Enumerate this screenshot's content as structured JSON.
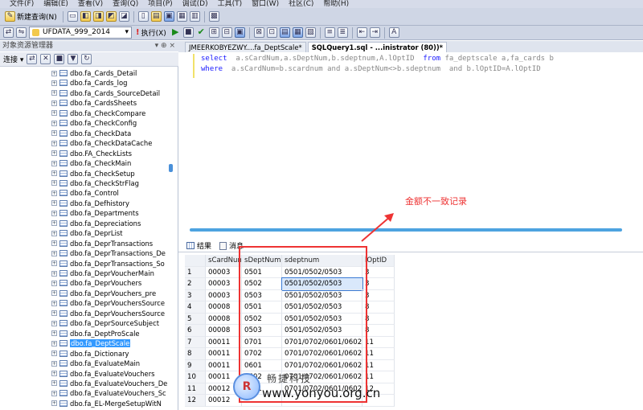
{
  "menu": {
    "items": [
      "文件(F)",
      "编辑(E)",
      "查看(V)",
      "查询(Q)",
      "项目(P)",
      "调试(D)",
      "工具(T)",
      "窗口(W)",
      "社区(C)",
      "帮助(H)"
    ]
  },
  "toolbar": {
    "new_query": "新建查询(N)",
    "database": "UFDATA_999_2014",
    "execute": "执行(X)"
  },
  "object_explorer": {
    "title": "对象资源管理器",
    "connect": "连接",
    "pin": "▾ ⊕ ×",
    "items": [
      "dbo.fa_Cards_Detail",
      "dbo.fa_Cards_log",
      "dbo.fa_Cards_SourceDetail",
      "dbo.fa_CardsSheets",
      "dbo.fa_CheckCompare",
      "dbo.fa_CheckConfig",
      "dbo.fa_CheckData",
      "dbo.fa_CheckDataCache",
      "dbo.FA_CheckLists",
      "dbo.fa_CheckMain",
      "dbo.fa_CheckSetup",
      "dbo.fa_CheckStrFlag",
      "dbo.fa_Control",
      "dbo.fa_Defhistory",
      "dbo.fa_Departments",
      "dbo.fa_Depreciations",
      "dbo.fa_DeprList",
      "dbo.fa_DeprTransactions",
      "dbo.fa_DeprTransactions_De",
      "dbo.fa_DeprTransactions_So",
      "dbo.fa_DeprVoucherMain",
      "dbo.fa_DeprVouchers",
      "dbo.fa_DeprVouchers_pre",
      "dbo.fa_DeprVouchersSource",
      "dbo.fa_DeprVouchersSource",
      "dbo.fa_DeprSourceSubject",
      "dbo.fa_DeptProScale",
      "dbo.fa_DeptScale",
      "dbo.fa_Dictionary",
      "dbo.fa_EvaluateMain",
      "dbo.fa_EvaluateVouchers",
      "dbo.fa_EvaluateVouchers_De",
      "dbo.fa_EvaluateVouchers_Sc",
      "dbo.fa_EL-MergeSetupWitN"
    ],
    "selected_index": 27
  },
  "tabs": [
    {
      "label": "JMEERKOBYEZWY....fa_DeptScale*"
    },
    {
      "label": "SQLQuery1.sql - ...inistrator (80))*"
    }
  ],
  "editor": {
    "line1": {
      "kw1": "select",
      "rest1": "  a.sCardNum,a.sDeptNum,b.sdeptnum,A.lOptID  ",
      "kw2": "from",
      "rest2": " fa_deptscale a,fa_cards b"
    },
    "line2": {
      "kw1": "where",
      "rest1": "  a.sCardNum=b.scardnum and a.sDeptNum<>b.sdeptnum  and b.lOptID=A.lOptID"
    }
  },
  "annotation": "金额不一致记录",
  "results": {
    "tab_results": "结果",
    "tab_messages": "消息",
    "columns": [
      "sCardNum",
      "sDeptNum",
      "sdeptnum",
      "lOptID"
    ],
    "rows": [
      [
        "1",
        "00003",
        "0501",
        "0501/0502/0503",
        "3"
      ],
      [
        "2",
        "00003",
        "0502",
        "0501/0502/0503",
        "3"
      ],
      [
        "3",
        "00003",
        "0503",
        "0501/0502/0503",
        "3"
      ],
      [
        "4",
        "00008",
        "0501",
        "0501/0502/0503",
        "8"
      ],
      [
        "5",
        "00008",
        "0502",
        "0501/0502/0503",
        "8"
      ],
      [
        "6",
        "00008",
        "0503",
        "0501/0502/0503",
        "8"
      ],
      [
        "7",
        "00011",
        "0701",
        "0701/0702/0601/0602",
        "11"
      ],
      [
        "8",
        "00011",
        "0702",
        "0701/0702/0601/0602",
        "11"
      ],
      [
        "9",
        "00011",
        "0601",
        "0701/0702/0601/0602",
        "11"
      ],
      [
        "10",
        "00011",
        "0602",
        "0701/0702/0601/0602",
        "11"
      ],
      [
        "11",
        "00012",
        "0701",
        "0701/0702/0601/0602",
        "12"
      ],
      [
        "12",
        "00012",
        "",
        "",
        ""
      ]
    ]
  },
  "watermark": {
    "cn": "畅捷科技",
    "url": "www.yonyou.org.cn",
    "logo": "R"
  }
}
